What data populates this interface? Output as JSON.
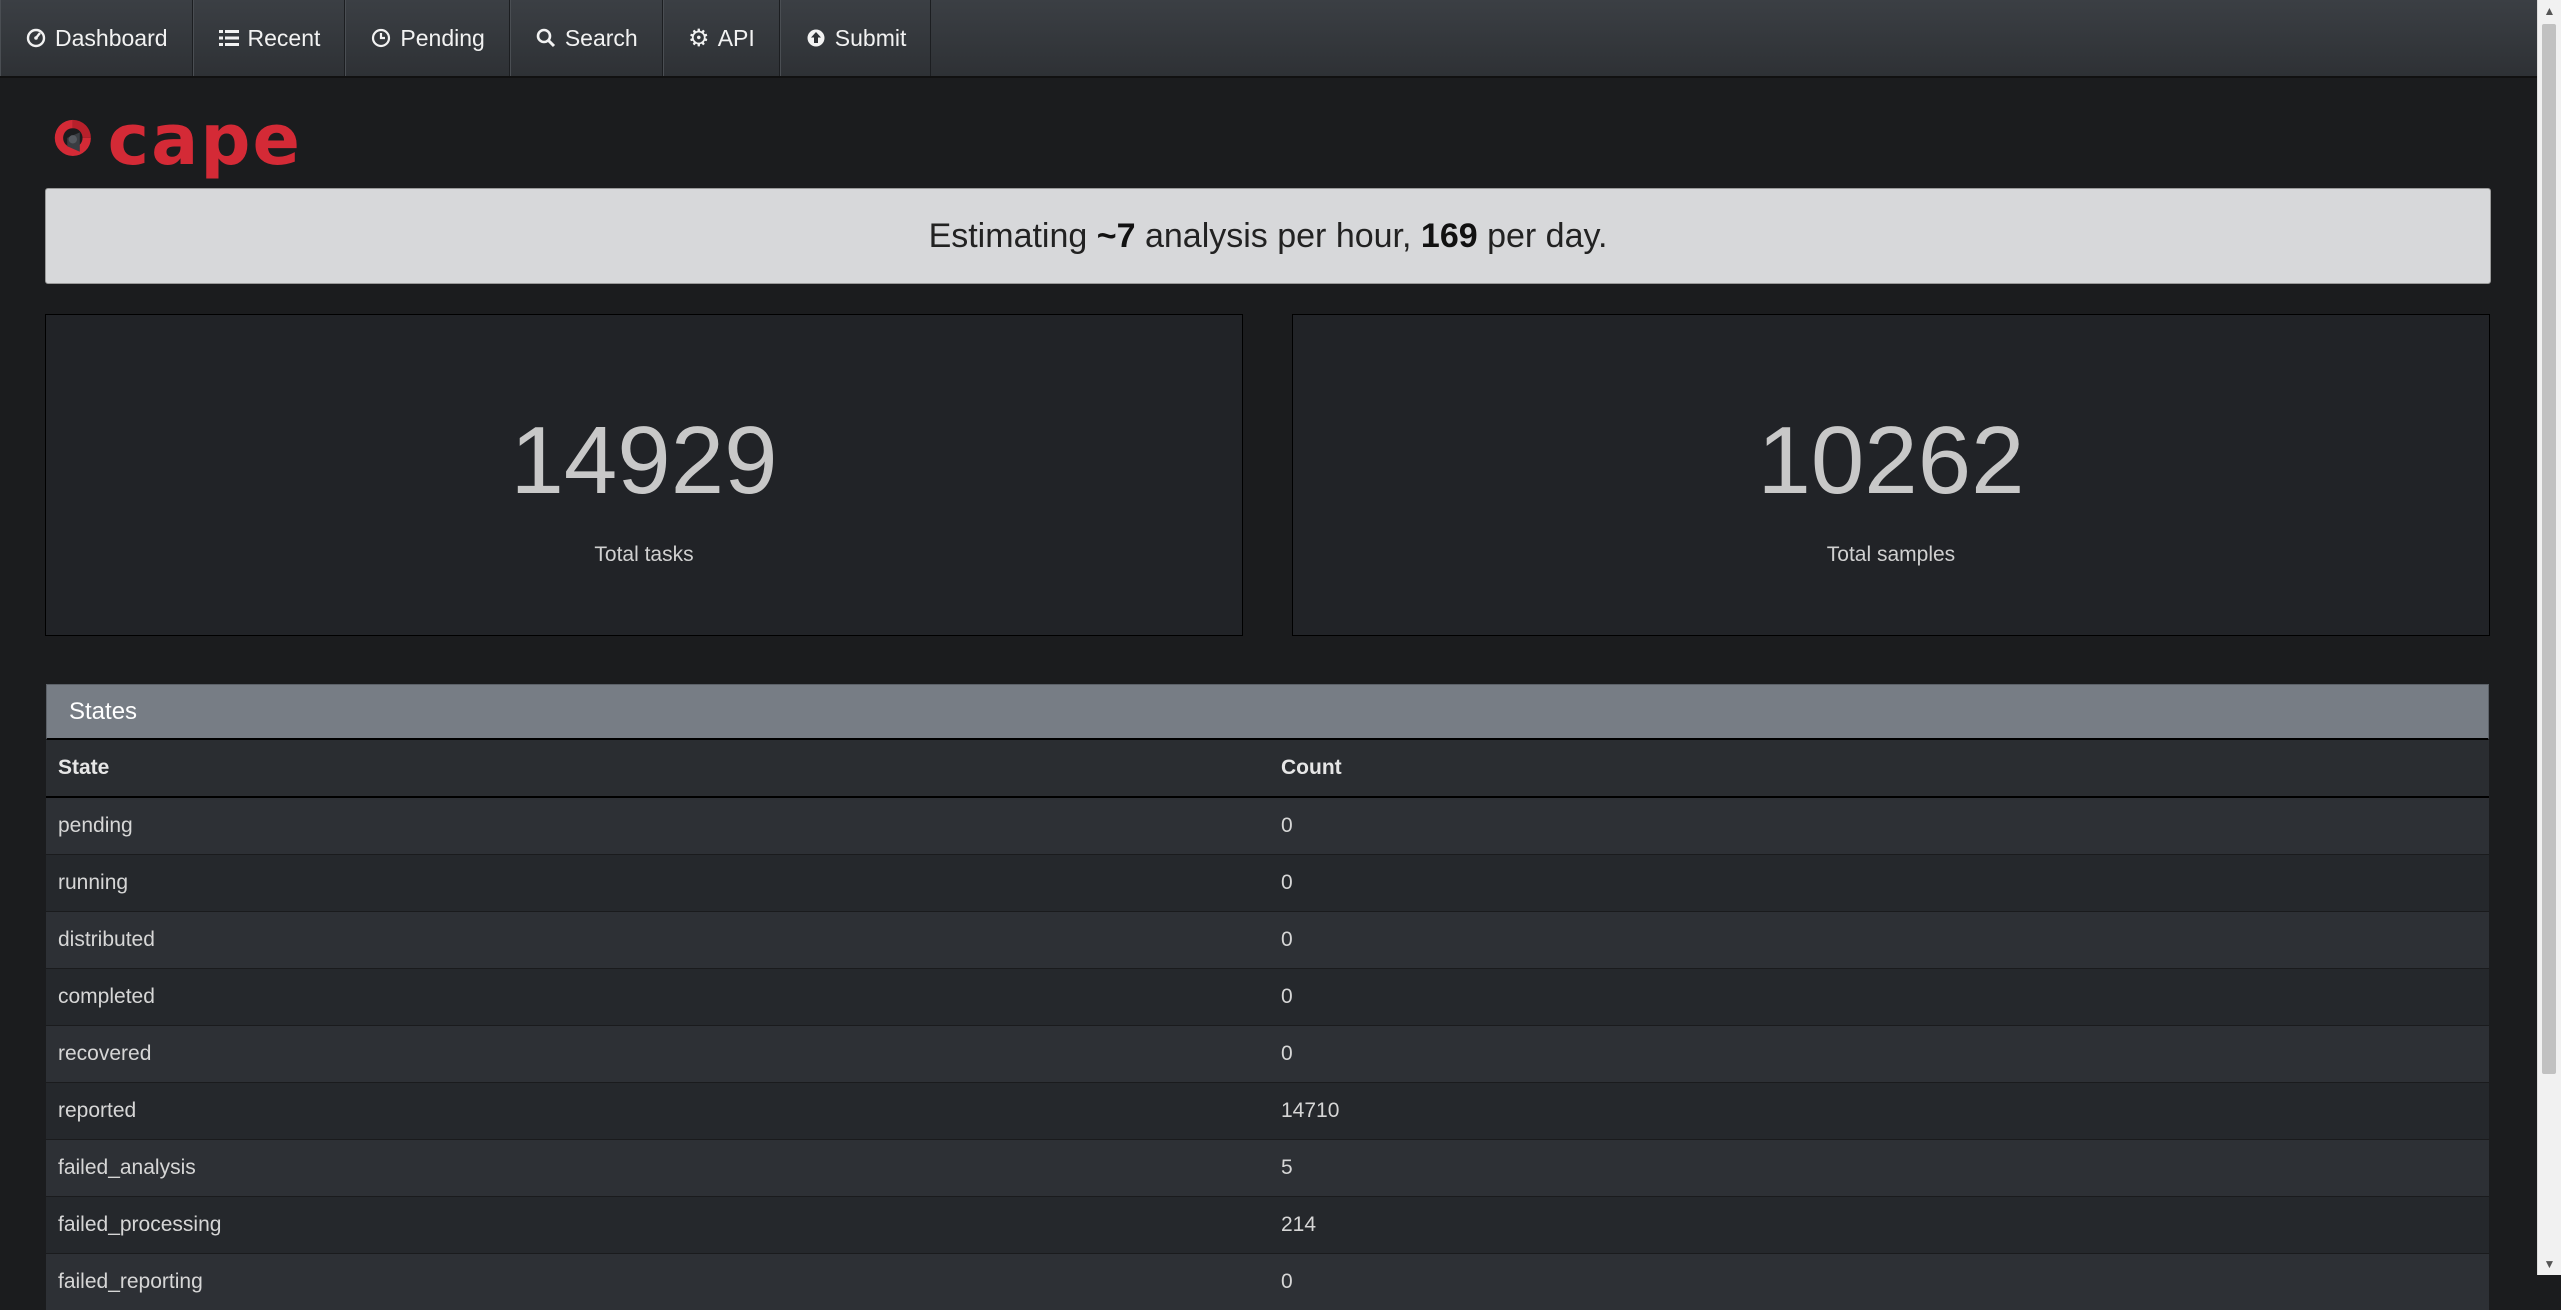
{
  "nav": {
    "items": [
      {
        "label": "Dashboard",
        "icon": "dashboard-icon"
      },
      {
        "label": "Recent",
        "icon": "list-icon"
      },
      {
        "label": "Pending",
        "icon": "clock-icon"
      },
      {
        "label": "Search",
        "icon": "search-icon"
      },
      {
        "label": "API",
        "icon": "gear-icon"
      },
      {
        "label": "Submit",
        "icon": "upload-icon"
      }
    ]
  },
  "logo": {
    "text": "cape",
    "color": "#d42a36"
  },
  "estimate": {
    "prefix": "Estimating ",
    "per_hour": "~7",
    "middle": " analysis per hour, ",
    "per_day": "169",
    "suffix": " per day."
  },
  "stats": [
    {
      "value": "14929",
      "label": "Total tasks"
    },
    {
      "value": "10262",
      "label": "Total samples"
    }
  ],
  "states": {
    "title": "States",
    "headers": [
      "State",
      "Count"
    ],
    "rows": [
      [
        "pending",
        "0"
      ],
      [
        "running",
        "0"
      ],
      [
        "distributed",
        "0"
      ],
      [
        "completed",
        "0"
      ],
      [
        "recovered",
        "0"
      ],
      [
        "reported",
        "14710"
      ],
      [
        "failed_analysis",
        "5"
      ],
      [
        "failed_processing",
        "214"
      ],
      [
        "failed_reporting",
        "0"
      ]
    ]
  }
}
